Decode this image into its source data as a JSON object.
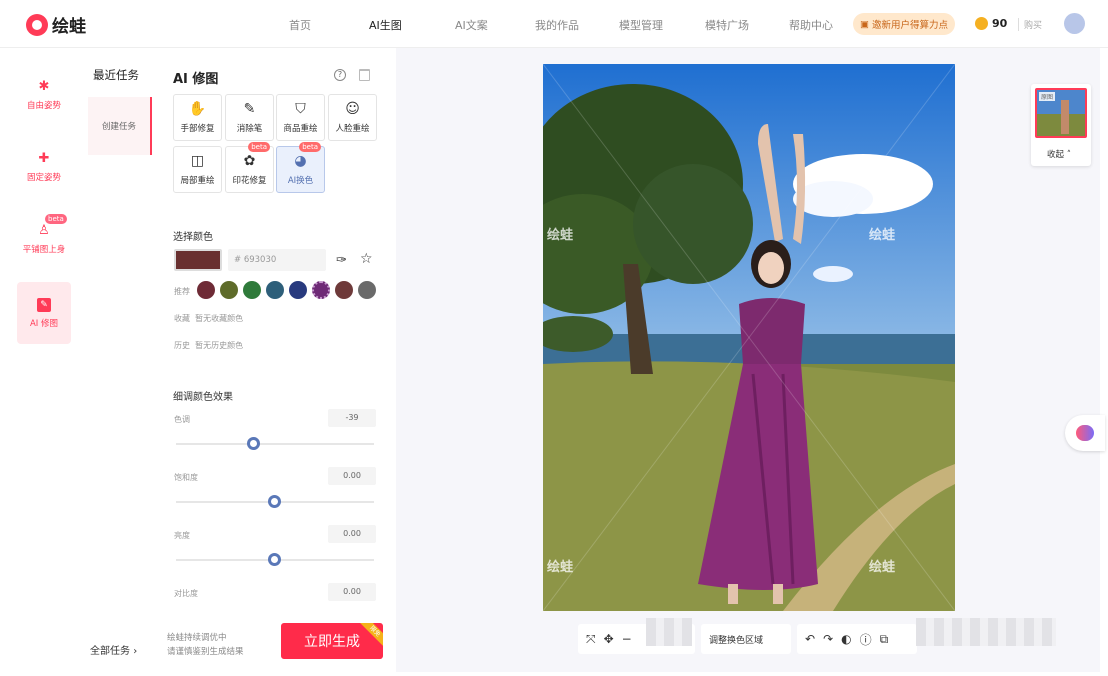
{
  "header": {
    "logo_text": "绘蛙",
    "nav": [
      "首页",
      "AI生图",
      "AI文案",
      "我的作品",
      "模型管理",
      "模特广场",
      "帮助中心"
    ],
    "active_nav": "AI生图",
    "promo": "邀新用户得算力点",
    "points": "90",
    "buy": "购买"
  },
  "rail": {
    "items": [
      {
        "label": "自由姿势",
        "icon": "figure-icon"
      },
      {
        "label": "固定姿势",
        "icon": "pose-icon"
      },
      {
        "label": "平铺图上身",
        "icon": "dress-icon",
        "badge": "beta"
      },
      {
        "label": "AI 修图",
        "icon": "retouch-icon",
        "active": true
      }
    ]
  },
  "recent": {
    "title": "最近任务",
    "create": "创建任务",
    "all": "全部任务"
  },
  "panel": {
    "title": "AI 修图",
    "tools": [
      {
        "label": "手部修复",
        "icon": "hand-icon"
      },
      {
        "label": "消除笔",
        "icon": "pen-icon"
      },
      {
        "label": "商品重绘",
        "icon": "shirt-icon"
      },
      {
        "label": "人脸重绘",
        "icon": "face-icon"
      },
      {
        "label": "局部重绘",
        "icon": "partial-icon"
      },
      {
        "label": "印花修复",
        "icon": "print-icon",
        "badge": "beta"
      },
      {
        "label": "AI换色",
        "icon": "palette-icon",
        "badge": "beta",
        "active": true
      }
    ],
    "select_color": "选择颜色",
    "hex_prefix": "#",
    "hex_value": "693030",
    "recommend": "推荐",
    "rec_colors": [
      "#6e2b36",
      "#5e6b2a",
      "#2f7a3a",
      "#2e5f7a",
      "#283a7e",
      "#6e2a76",
      "#6e3a3a",
      "#6a6a6a"
    ],
    "favorites_label": "收藏",
    "favorites_empty": "暂无收藏颜色",
    "history_label": "历史",
    "history_empty": "暂无历史颜色",
    "fine_tune": "细调颜色效果",
    "adjustments": [
      {
        "label": "色调",
        "value": "-39",
        "position": 0.39
      },
      {
        "label": "饱和度",
        "value": "0.00",
        "position": 0.5
      },
      {
        "label": "亮度",
        "value": "0.00",
        "position": 0.5
      },
      {
        "label": "对比度",
        "value": "0.00",
        "position": 0.5
      }
    ],
    "footer_note_1": "绘蛙持续调优中",
    "footer_note_2": "请谨慎鉴别生成结果",
    "generate": "立即生成",
    "generate_corner": "限免"
  },
  "canvas": {
    "watermark": "绘蛙",
    "thumb_tag": "原图",
    "collapse": "收起",
    "toolbar_label": "调整换色区域"
  }
}
